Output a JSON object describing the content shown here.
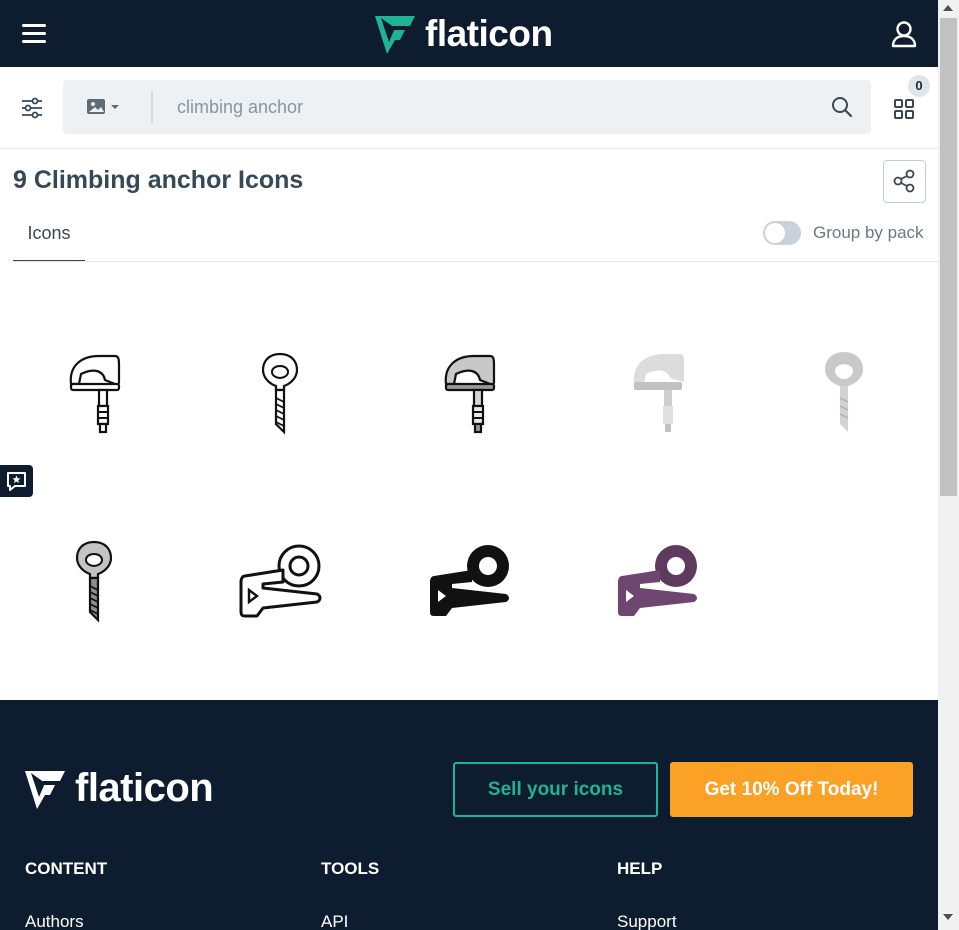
{
  "header": {
    "brand": "flaticon",
    "menu_icon": "hamburger-icon",
    "user_icon": "user-icon"
  },
  "search": {
    "filter_icon": "sliders-icon",
    "type_icon": "image-icon",
    "query": "climbing anchor",
    "search_icon": "search-icon",
    "collection_icon": "grid-icon",
    "collection_count": "0"
  },
  "results": {
    "title": "9 Climbing anchor Icons",
    "share_icon": "share-icon",
    "tab_label": "Icons",
    "group_by_pack_label": "Group by pack",
    "group_by_pack_on": false,
    "icons": [
      {
        "name": "anchor-bolt-outline-icon",
        "style": "lineal"
      },
      {
        "name": "eye-bolt-outline-icon",
        "style": "lineal"
      },
      {
        "name": "anchor-bolt-lineal-color-icon",
        "style": "lineal-color"
      },
      {
        "name": "anchor-bolt-flat-icon",
        "style": "flat"
      },
      {
        "name": "eye-bolt-flat-icon",
        "style": "flat"
      },
      {
        "name": "eye-bolt-lineal-color-icon",
        "style": "lineal-color"
      },
      {
        "name": "piton-outline-icon",
        "style": "lineal"
      },
      {
        "name": "piton-glyph-icon",
        "style": "glyph"
      },
      {
        "name": "piton-purple-icon",
        "style": "flat"
      }
    ]
  },
  "feedback_icon": "feedback-icon",
  "footer": {
    "brand": "flaticon",
    "sell_label": "Sell your icons",
    "offer_label": "Get 10% Off Today!",
    "columns": [
      {
        "heading": "CONTENT",
        "first_link": "Authors"
      },
      {
        "heading": "TOOLS",
        "first_link": "API"
      },
      {
        "heading": "HELP",
        "first_link": "Support"
      }
    ]
  },
  "colors": {
    "nav_bg": "#0e1c2f",
    "accent_green": "#1fb393",
    "accent_orange": "#fba226",
    "text_dark": "#374957"
  }
}
